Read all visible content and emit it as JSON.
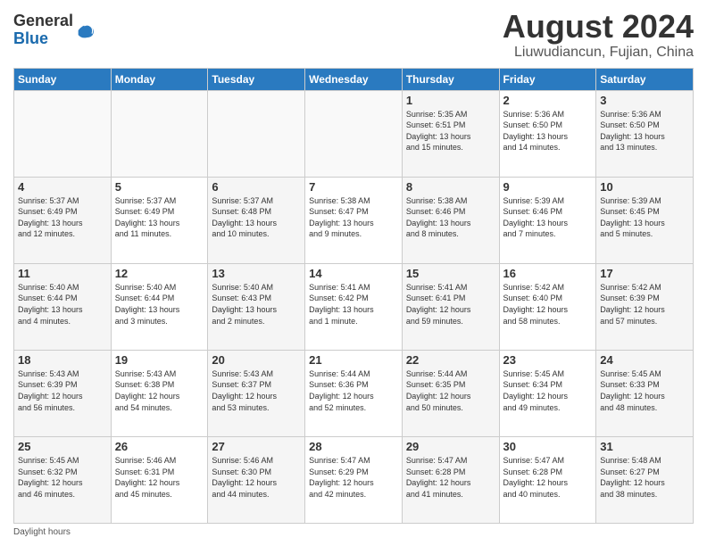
{
  "header": {
    "logo_line1": "General",
    "logo_line2": "Blue",
    "title": "August 2024",
    "subtitle": "Liuwudiancun, Fujian, China"
  },
  "days_of_week": [
    "Sunday",
    "Monday",
    "Tuesday",
    "Wednesday",
    "Thursday",
    "Friday",
    "Saturday"
  ],
  "weeks": [
    [
      {
        "day": "",
        "info": ""
      },
      {
        "day": "",
        "info": ""
      },
      {
        "day": "",
        "info": ""
      },
      {
        "day": "",
        "info": ""
      },
      {
        "day": "1",
        "info": "Sunrise: 5:35 AM\nSunset: 6:51 PM\nDaylight: 13 hours\nand 15 minutes."
      },
      {
        "day": "2",
        "info": "Sunrise: 5:36 AM\nSunset: 6:50 PM\nDaylight: 13 hours\nand 14 minutes."
      },
      {
        "day": "3",
        "info": "Sunrise: 5:36 AM\nSunset: 6:50 PM\nDaylight: 13 hours\nand 13 minutes."
      }
    ],
    [
      {
        "day": "4",
        "info": "Sunrise: 5:37 AM\nSunset: 6:49 PM\nDaylight: 13 hours\nand 12 minutes."
      },
      {
        "day": "5",
        "info": "Sunrise: 5:37 AM\nSunset: 6:49 PM\nDaylight: 13 hours\nand 11 minutes."
      },
      {
        "day": "6",
        "info": "Sunrise: 5:37 AM\nSunset: 6:48 PM\nDaylight: 13 hours\nand 10 minutes."
      },
      {
        "day": "7",
        "info": "Sunrise: 5:38 AM\nSunset: 6:47 PM\nDaylight: 13 hours\nand 9 minutes."
      },
      {
        "day": "8",
        "info": "Sunrise: 5:38 AM\nSunset: 6:46 PM\nDaylight: 13 hours\nand 8 minutes."
      },
      {
        "day": "9",
        "info": "Sunrise: 5:39 AM\nSunset: 6:46 PM\nDaylight: 13 hours\nand 7 minutes."
      },
      {
        "day": "10",
        "info": "Sunrise: 5:39 AM\nSunset: 6:45 PM\nDaylight: 13 hours\nand 5 minutes."
      }
    ],
    [
      {
        "day": "11",
        "info": "Sunrise: 5:40 AM\nSunset: 6:44 PM\nDaylight: 13 hours\nand 4 minutes."
      },
      {
        "day": "12",
        "info": "Sunrise: 5:40 AM\nSunset: 6:44 PM\nDaylight: 13 hours\nand 3 minutes."
      },
      {
        "day": "13",
        "info": "Sunrise: 5:40 AM\nSunset: 6:43 PM\nDaylight: 13 hours\nand 2 minutes."
      },
      {
        "day": "14",
        "info": "Sunrise: 5:41 AM\nSunset: 6:42 PM\nDaylight: 13 hours\nand 1 minute."
      },
      {
        "day": "15",
        "info": "Sunrise: 5:41 AM\nSunset: 6:41 PM\nDaylight: 12 hours\nand 59 minutes."
      },
      {
        "day": "16",
        "info": "Sunrise: 5:42 AM\nSunset: 6:40 PM\nDaylight: 12 hours\nand 58 minutes."
      },
      {
        "day": "17",
        "info": "Sunrise: 5:42 AM\nSunset: 6:39 PM\nDaylight: 12 hours\nand 57 minutes."
      }
    ],
    [
      {
        "day": "18",
        "info": "Sunrise: 5:43 AM\nSunset: 6:39 PM\nDaylight: 12 hours\nand 56 minutes."
      },
      {
        "day": "19",
        "info": "Sunrise: 5:43 AM\nSunset: 6:38 PM\nDaylight: 12 hours\nand 54 minutes."
      },
      {
        "day": "20",
        "info": "Sunrise: 5:43 AM\nSunset: 6:37 PM\nDaylight: 12 hours\nand 53 minutes."
      },
      {
        "day": "21",
        "info": "Sunrise: 5:44 AM\nSunset: 6:36 PM\nDaylight: 12 hours\nand 52 minutes."
      },
      {
        "day": "22",
        "info": "Sunrise: 5:44 AM\nSunset: 6:35 PM\nDaylight: 12 hours\nand 50 minutes."
      },
      {
        "day": "23",
        "info": "Sunrise: 5:45 AM\nSunset: 6:34 PM\nDaylight: 12 hours\nand 49 minutes."
      },
      {
        "day": "24",
        "info": "Sunrise: 5:45 AM\nSunset: 6:33 PM\nDaylight: 12 hours\nand 48 minutes."
      }
    ],
    [
      {
        "day": "25",
        "info": "Sunrise: 5:45 AM\nSunset: 6:32 PM\nDaylight: 12 hours\nand 46 minutes."
      },
      {
        "day": "26",
        "info": "Sunrise: 5:46 AM\nSunset: 6:31 PM\nDaylight: 12 hours\nand 45 minutes."
      },
      {
        "day": "27",
        "info": "Sunrise: 5:46 AM\nSunset: 6:30 PM\nDaylight: 12 hours\nand 44 minutes."
      },
      {
        "day": "28",
        "info": "Sunrise: 5:47 AM\nSunset: 6:29 PM\nDaylight: 12 hours\nand 42 minutes."
      },
      {
        "day": "29",
        "info": "Sunrise: 5:47 AM\nSunset: 6:28 PM\nDaylight: 12 hours\nand 41 minutes."
      },
      {
        "day": "30",
        "info": "Sunrise: 5:47 AM\nSunset: 6:28 PM\nDaylight: 12 hours\nand 40 minutes."
      },
      {
        "day": "31",
        "info": "Sunrise: 5:48 AM\nSunset: 6:27 PM\nDaylight: 12 hours\nand 38 minutes."
      }
    ]
  ],
  "footer": {
    "daylight_label": "Daylight hours"
  }
}
